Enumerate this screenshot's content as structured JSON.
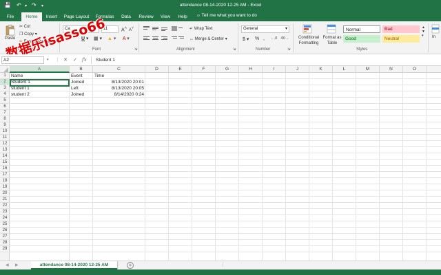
{
  "window": {
    "title": "attendance 08-14-2020 12-25 AM  -  Excel"
  },
  "ribbon_tabs": [
    "File",
    "Home",
    "Insert",
    "Page Layout",
    "Formulas",
    "Data",
    "Review",
    "View",
    "Help"
  ],
  "active_tab": "Home",
  "tell_me": "Tell me what you want to do",
  "clipboard": {
    "paste": "Paste",
    "cut": "Cut",
    "copy": "Copy",
    "format_painter": "Format Painter",
    "label": "Clipboard"
  },
  "font": {
    "name": "Ca",
    "size": "11",
    "label": "Font"
  },
  "alignment": {
    "wrap_text": "Wrap Text",
    "merge_center": "Merge & Center",
    "label": "Alignment"
  },
  "number": {
    "format": "General",
    "label": "Number"
  },
  "styles": {
    "conditional_formatting": "Conditional Formatting",
    "format_as_table": "Format as Table",
    "normal": "Normal",
    "bad": "Bad",
    "good": "Good",
    "neutral": "Neutral",
    "label": "Styles"
  },
  "name_box": "A2",
  "formula_content": "Student 1",
  "columns": [
    "A",
    "B",
    "C",
    "D",
    "E",
    "F",
    "G",
    "H",
    "I",
    "J",
    "K",
    "L",
    "M",
    "N",
    "O"
  ],
  "rows": [
    [
      "Name",
      "Event",
      "Time"
    ],
    [
      "Student 1",
      "Joined",
      "8/13/2020 20:01"
    ],
    [
      "student 1",
      "Left",
      "8/13/2020 20:05"
    ],
    [
      "student 2",
      "Joined",
      "8/14/2020 0:24"
    ]
  ],
  "row_count": 29,
  "sheet_tab": "attendance 08-14-2020 12-25 AM",
  "add_sheet": "+",
  "watermark": "数据乐isasso66",
  "colors": {
    "excel_green": "#217346",
    "bad_bg": "#ffc7ce",
    "bad_fg": "#9c0006",
    "good_bg": "#c6efce",
    "good_fg": "#006100",
    "neutral_bg": "#ffeb9c",
    "neutral_fg": "#9c5700"
  }
}
